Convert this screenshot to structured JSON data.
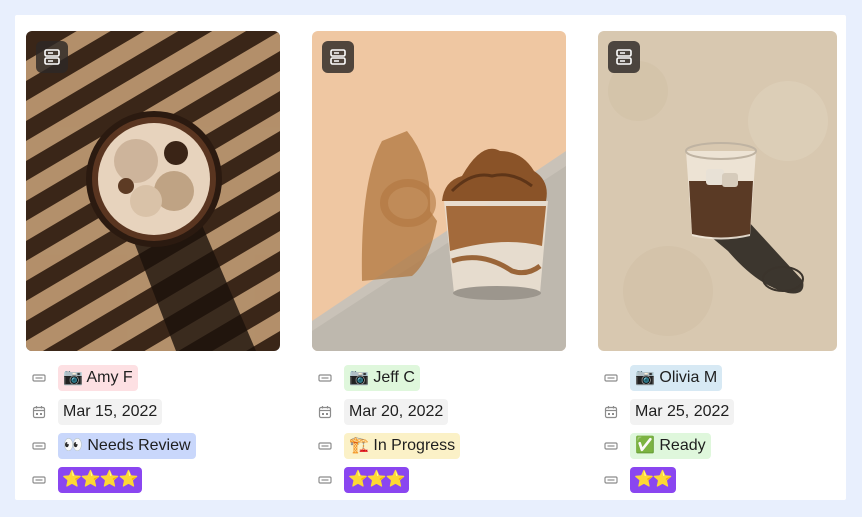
{
  "cards": [
    {
      "photographer": "📷 Amy F",
      "date": "Mar 15, 2022",
      "status": "👀 Needs Review",
      "rating": "⭐⭐⭐⭐"
    },
    {
      "photographer": "📷 Jeff C",
      "date": "Mar 20, 2022",
      "status": "🏗️ In Progress",
      "rating": "⭐⭐⭐"
    },
    {
      "photographer": "📷 Olivia M",
      "date": "Mar 25, 2022",
      "status": "✅ Ready",
      "rating": "⭐⭐"
    }
  ],
  "colors": {
    "page_bg": "#e8effd",
    "tag_pink": "#fde0e3",
    "tag_green": "#dff7dc",
    "tag_blue": "#d7e9f4",
    "tag_periwinkle": "#c9d7fb",
    "tag_yellow": "#fbf1c7",
    "tag_purple": "#8a46f0"
  },
  "icons": {
    "card_type": "database-card-icon",
    "text_property": "text-property-icon",
    "date_property": "calendar-icon",
    "select_property": "select-property-icon"
  }
}
